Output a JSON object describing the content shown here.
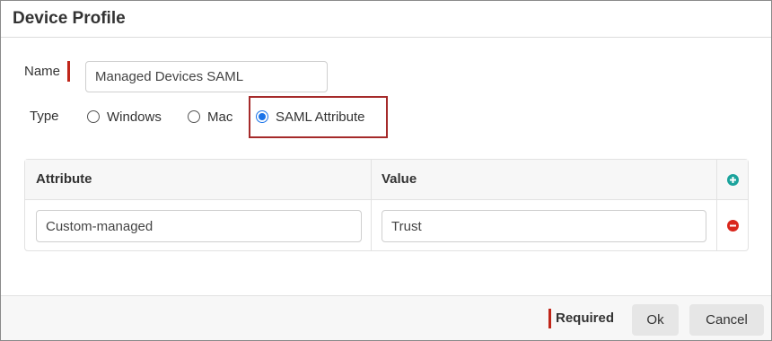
{
  "dialog": {
    "title": "Device Profile"
  },
  "form": {
    "name_label": "Name",
    "name_value": "Managed Devices SAML",
    "type_label": "Type",
    "type_options": [
      {
        "label": "Windows",
        "selected": false
      },
      {
        "label": "Mac",
        "selected": false
      },
      {
        "label": "SAML Attribute",
        "selected": true
      }
    ]
  },
  "table": {
    "headers": {
      "attribute": "Attribute",
      "value": "Value"
    },
    "rows": [
      {
        "attribute": "Custom-managed",
        "value": "Trust"
      }
    ],
    "add_icon": "plus-circle-icon",
    "remove_icon": "minus-circle-icon"
  },
  "footer": {
    "required_label": "Required",
    "ok_label": "Ok",
    "cancel_label": "Cancel"
  },
  "colors": {
    "required_marker": "#c0261a",
    "highlight_border": "#a52a2a",
    "radio_selected": "#1a73e8",
    "add_icon": "#1ba39c",
    "remove_icon": "#d9261c"
  }
}
